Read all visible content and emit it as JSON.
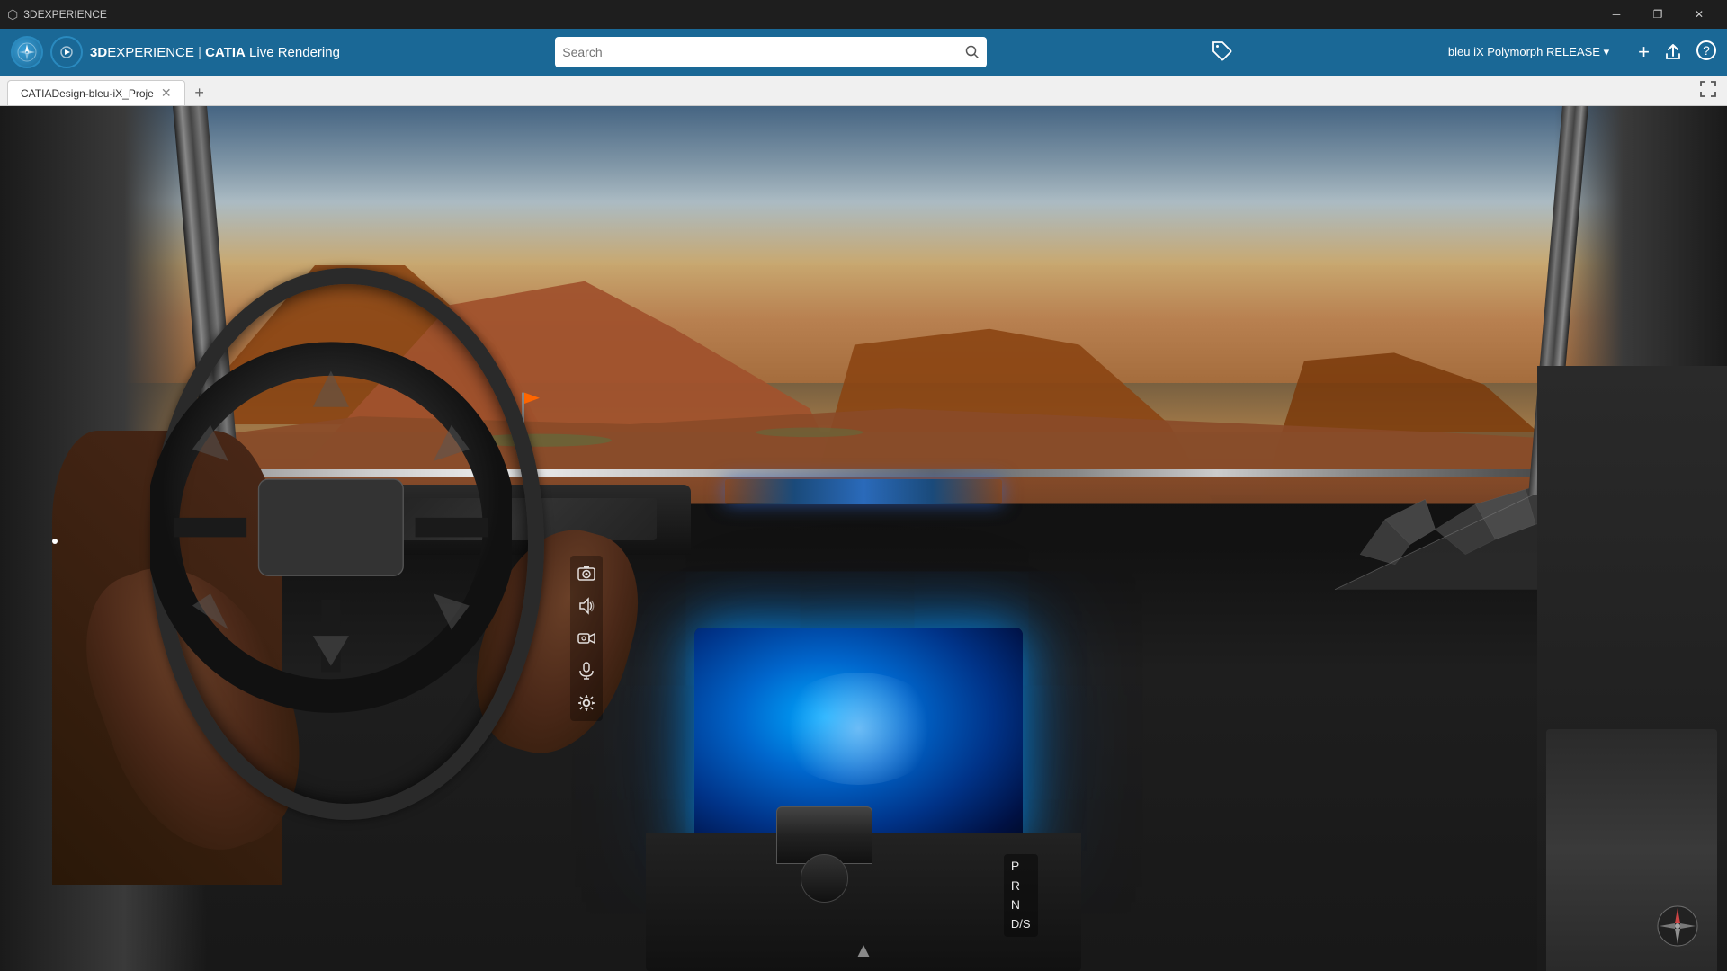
{
  "titleBar": {
    "title": "3DEXPERIENCE",
    "icon": "⬡"
  },
  "windowControls": {
    "minimize": "─",
    "restore": "❐",
    "close": "✕"
  },
  "navBar": {
    "appName": "3DEXPERIENCE",
    "separator": " | ",
    "module": "CATIA",
    "subModule": " Live Rendering",
    "playButton": "▶",
    "search": {
      "placeholder": "Search",
      "value": ""
    },
    "tagIcon": "🏷",
    "userProfile": "bleu iX Polymorph RELEASE ▾",
    "actions": {
      "add": "+",
      "share": "⬆",
      "help": "?"
    }
  },
  "tabBar": {
    "activeTab": "CATIADesign-bleu-iX_Proje",
    "addTab": "+",
    "expandIcon": "⤢"
  },
  "toolbar": {
    "buttons": [
      {
        "name": "camera-tool",
        "icon": "📷"
      },
      {
        "name": "audio-tool",
        "icon": "🔊"
      },
      {
        "name": "video-tool",
        "icon": "📹"
      },
      {
        "name": "record-tool",
        "icon": "🎙"
      },
      {
        "name": "settings-tool",
        "icon": "⚙"
      }
    ]
  },
  "gearShifter": {
    "positions": [
      "P",
      "R",
      "N",
      "D/S"
    ]
  },
  "compass": {
    "directions": "↗"
  },
  "navArrow": "▲"
}
